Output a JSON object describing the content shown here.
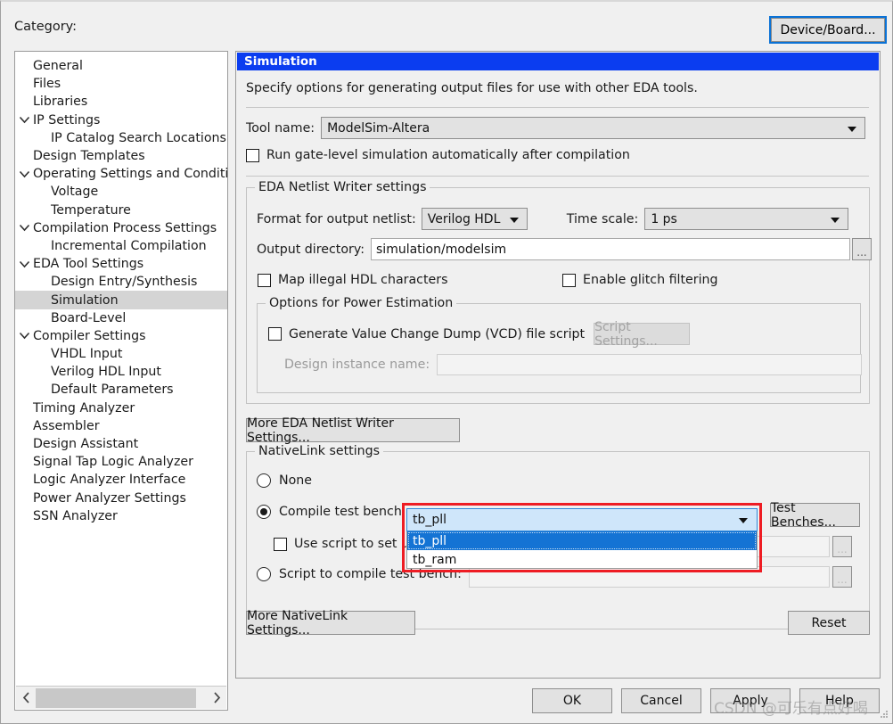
{
  "header": {
    "category_label": "Category:",
    "device_board_button": "Device/Board..."
  },
  "sidebar": {
    "items": [
      {
        "label": "General",
        "depth": 0,
        "twisty": "none",
        "selected": false
      },
      {
        "label": "Files",
        "depth": 0,
        "twisty": "none",
        "selected": false
      },
      {
        "label": "Libraries",
        "depth": 0,
        "twisty": "none",
        "selected": false
      },
      {
        "label": "IP Settings",
        "depth": 0,
        "twisty": "expanded",
        "selected": false
      },
      {
        "label": "IP Catalog Search Locations",
        "depth": 1,
        "twisty": "none",
        "selected": false
      },
      {
        "label": "Design Templates",
        "depth": 0,
        "twisty": "none",
        "selected": false
      },
      {
        "label": "Operating Settings and Conditions",
        "depth": 0,
        "twisty": "expanded",
        "selected": false
      },
      {
        "label": "Voltage",
        "depth": 1,
        "twisty": "none",
        "selected": false
      },
      {
        "label": "Temperature",
        "depth": 1,
        "twisty": "none",
        "selected": false
      },
      {
        "label": "Compilation Process Settings",
        "depth": 0,
        "twisty": "expanded",
        "selected": false
      },
      {
        "label": "Incremental Compilation",
        "depth": 1,
        "twisty": "none",
        "selected": false
      },
      {
        "label": "EDA Tool Settings",
        "depth": 0,
        "twisty": "expanded",
        "selected": false
      },
      {
        "label": "Design Entry/Synthesis",
        "depth": 1,
        "twisty": "none",
        "selected": false
      },
      {
        "label": "Simulation",
        "depth": 1,
        "twisty": "none",
        "selected": true
      },
      {
        "label": "Board-Level",
        "depth": 1,
        "twisty": "none",
        "selected": false
      },
      {
        "label": "Compiler Settings",
        "depth": 0,
        "twisty": "expanded",
        "selected": false
      },
      {
        "label": "VHDL Input",
        "depth": 1,
        "twisty": "none",
        "selected": false
      },
      {
        "label": "Verilog HDL Input",
        "depth": 1,
        "twisty": "none",
        "selected": false
      },
      {
        "label": "Default Parameters",
        "depth": 1,
        "twisty": "none",
        "selected": false
      },
      {
        "label": "Timing Analyzer",
        "depth": 0,
        "twisty": "none",
        "selected": false
      },
      {
        "label": "Assembler",
        "depth": 0,
        "twisty": "none",
        "selected": false
      },
      {
        "label": "Design Assistant",
        "depth": 0,
        "twisty": "none",
        "selected": false
      },
      {
        "label": "Signal Tap Logic Analyzer",
        "depth": 0,
        "twisty": "none",
        "selected": false
      },
      {
        "label": "Logic Analyzer Interface",
        "depth": 0,
        "twisty": "none",
        "selected": false
      },
      {
        "label": "Power Analyzer Settings",
        "depth": 0,
        "twisty": "none",
        "selected": false
      },
      {
        "label": "SSN Analyzer",
        "depth": 0,
        "twisty": "none",
        "selected": false
      }
    ],
    "scroll_left_icon": "chevron-left-icon",
    "scroll_right_icon": "chevron-right-icon"
  },
  "panel": {
    "title": "Simulation",
    "description": "Specify options for generating output files for use with other EDA tools.",
    "tool_name_label": "Tool name:",
    "tool_name_value": "ModelSim-Altera",
    "run_gate_level_label": "Run gate-level simulation automatically after compilation",
    "run_gate_level_checked": false
  },
  "eda_netlist": {
    "group_title": "EDA Netlist Writer settings",
    "format_label": "Format for output netlist:",
    "format_value": "Verilog HDL",
    "time_scale_label": "Time scale:",
    "time_scale_value": "1 ps",
    "output_dir_label": "Output directory:",
    "output_dir_value": "simulation/modelsim",
    "browse_icon": "ellipsis-icon",
    "map_illegal_label": "Map illegal HDL characters",
    "map_illegal_checked": false,
    "glitch_label": "Enable glitch filtering",
    "glitch_checked": false
  },
  "power_estimation": {
    "group_title": "Options for Power Estimation",
    "vcd_label": "Generate Value Change Dump (VCD) file script",
    "vcd_checked": false,
    "script_settings_button": "Script Settings...",
    "design_instance_label": "Design instance name:",
    "design_instance_value": ""
  },
  "more_eda_button": "More EDA Netlist Writer Settings...",
  "nativelink": {
    "group_title": "NativeLink settings",
    "none_label": "None",
    "none_selected": false,
    "compile_tb_label": "Compile test bench:",
    "compile_tb_selected": true,
    "compile_tb_value": "tb_pll",
    "test_benches_button": "Test Benches...",
    "use_script_label": "Use script to set up simulation",
    "use_script_checked": false,
    "use_script_value": "",
    "script_compile_label": "Script to compile test bench:",
    "script_compile_selected": false,
    "script_compile_value": "",
    "dropdown_options": [
      "tb_pll",
      "tb_ram"
    ],
    "dropdown_selected_index": 0,
    "browse_icon": "ellipsis-icon"
  },
  "footer": {
    "more_nativelink_button": "More NativeLink Settings...",
    "reset_button": "Reset",
    "ok_button": "OK",
    "cancel_button": "Cancel",
    "apply_button": "Apply",
    "help_button": "Help"
  },
  "watermark": "CSDN @可乐有点好喝",
  "colors": {
    "title_bar": "#0b3df0",
    "accent_highlight": "#1473d4",
    "annotation_red": "#ee1c23",
    "focus_blue": "#0a72d6",
    "combo_open_bg": "#cfe6fa",
    "window_bg": "#f0f0f0"
  }
}
